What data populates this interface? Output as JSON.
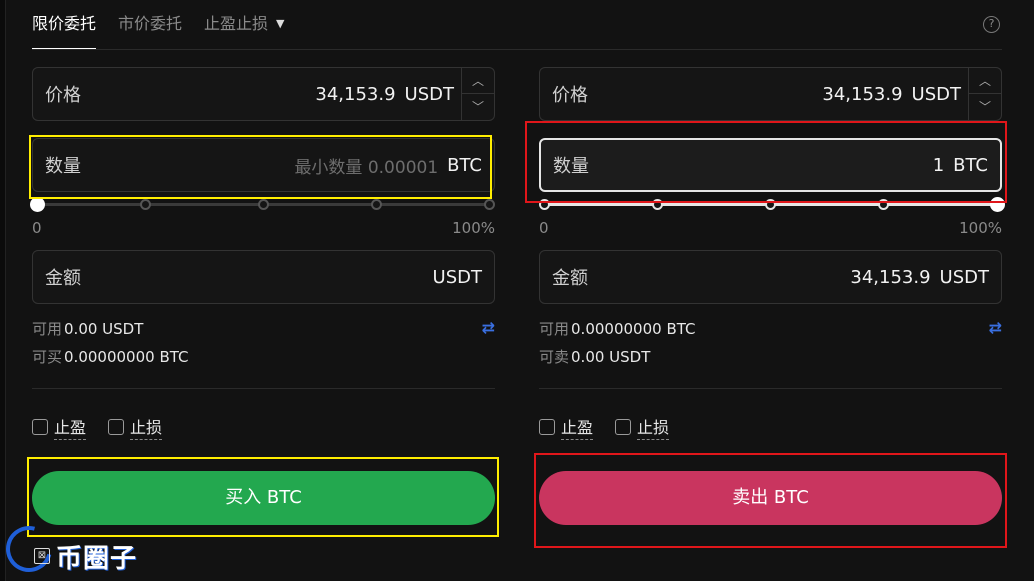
{
  "tabs": [
    {
      "label": "限价委托",
      "active": true
    },
    {
      "label": "市价委托",
      "active": false
    },
    {
      "label": "止盈止损",
      "active": false,
      "dropdown": true
    }
  ],
  "icons": {
    "help": "help-circle-icon",
    "swap": "swap-arrows-icon",
    "dropdown": "chevron-down-icon",
    "stepper_up": "chevron-up-icon",
    "stepper_down": "chevron-down-icon"
  },
  "buy": {
    "price_label": "价格",
    "price_value": "34,153.9",
    "price_unit": "USDT",
    "qty_label": "数量",
    "qty_placeholder": "最小数量 0.00001",
    "qty_unit": "BTC",
    "slider_value": 0,
    "slider_min": "0",
    "slider_max": "100%",
    "amount_label": "金额",
    "amount_value": "",
    "amount_unit": "USDT",
    "available_label": "可用",
    "available_value": "0.00 USDT",
    "max_label": "可买",
    "max_value": "0.00000000 BTC",
    "take_profit": "止盈",
    "stop_loss": "止损",
    "button": "买入 BTC"
  },
  "sell": {
    "price_label": "价格",
    "price_value": "34,153.9",
    "price_unit": "USDT",
    "qty_label": "数量",
    "qty_value": "1",
    "qty_unit": "BTC",
    "slider_value": 1,
    "slider_min": "0",
    "slider_max": "100%",
    "amount_label": "金额",
    "amount_value": "34,153.9",
    "amount_unit": "USDT",
    "available_label": "可用",
    "available_value": "0.00000000 BTC",
    "max_label": "可卖",
    "max_value": "0.00 USDT",
    "take_profit": "止盈",
    "stop_loss": "止损",
    "button": "卖出 BTC"
  },
  "colors": {
    "buy": "#23a84f",
    "sell": "#c9355f",
    "highlight_yellow": "#ffee00",
    "highlight_red": "#e0161a",
    "accent": "#3a6fe0"
  },
  "watermark": {
    "text": "币圈子"
  }
}
